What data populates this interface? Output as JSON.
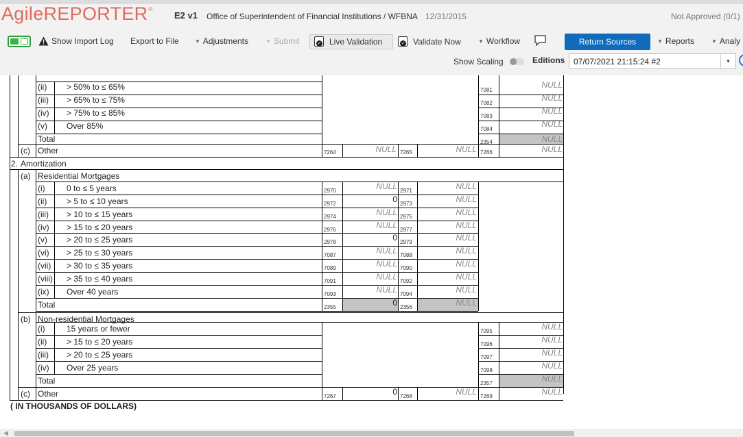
{
  "header": {
    "logo_text": "AgileREPORTER",
    "logo_mark": "®",
    "version": "E2 v1",
    "organization": "Office of Superintendent of Financial Institutions / WFBNA",
    "period_date": "12/31/2015",
    "approval_status": "Not Approved (0/1)"
  },
  "toolbar": {
    "show_import_log": "Show Import Log",
    "export_to_file": "Export to File",
    "adjustments": "Adjustments",
    "submit": "Submit",
    "live_validation": "Live Validation",
    "validate_now": "Validate Now",
    "workflow": "Workflow",
    "return_sources": "Return Sources",
    "reports": "Reports",
    "analysis": "Analy",
    "show_scaling": "Show Scaling",
    "editions_label": "Editions",
    "edition_value": "07/07/2021 21:15:24 #2"
  },
  "colors": {
    "brand": "#e36a5c",
    "primary_button": "#0f6cbd",
    "null_text": "#888888",
    "disabled_cell": "#c4c4c4"
  },
  "form": {
    "section1_rows": [
      {
        "num": "(ii)",
        "label": "> 50% to ≤ 65%",
        "code": "7081",
        "value": "NULL"
      },
      {
        "num": "(iii)",
        "label": "> 65% to ≤ 75%",
        "code": "7082",
        "value": "NULL"
      },
      {
        "num": "(iv)",
        "label": "> 75% to ≤ 85%",
        "code": "7083",
        "value": "NULL"
      },
      {
        "num": "(v)",
        "label": "Over 85%",
        "code": "7084",
        "value": "NULL"
      },
      {
        "num": "",
        "label": "Total",
        "code": "2354",
        "value": "NULL"
      }
    ],
    "other1": {
      "num": "(c)",
      "label": "Other",
      "code1": "7264",
      "val1": "NULL",
      "code2": "7265",
      "val2": "NULL",
      "code3": "7266",
      "val3": "NULL"
    },
    "section2": {
      "num": "2.",
      "label": "Amortization"
    },
    "res_mortgages": {
      "num": "(a)",
      "label": "Residential Mortgages"
    },
    "res_rows": [
      {
        "num": "(i)",
        "label": "0 to ≤ 5 years",
        "code1": "2970",
        "val1": "NULL",
        "code2": "2971",
        "val2": "NULL"
      },
      {
        "num": "(ii)",
        "label": "> 5 to ≤ 10 years",
        "code1": "2972",
        "val1": "0",
        "code2": "2973",
        "val2": "NULL"
      },
      {
        "num": "(iii)",
        "label": "> 10 to ≤ 15 years",
        "code1": "2974",
        "val1": "NULL",
        "code2": "2975",
        "val2": "NULL"
      },
      {
        "num": "(iv)",
        "label": "> 15 to ≤ 20 years",
        "code1": "2976",
        "val1": "NULL",
        "code2": "2977",
        "val2": "NULL"
      },
      {
        "num": "(v)",
        "label": "> 20 to ≤ 25 years",
        "code1": "2978",
        "val1": "0",
        "code2": "2979",
        "val2": "NULL"
      },
      {
        "num": "(vi)",
        "label": "> 25 to ≤ 30 years",
        "code1": "7087",
        "val1": "NULL",
        "code2": "7088",
        "val2": "NULL"
      },
      {
        "num": "(vii)",
        "label": "> 30 to ≤ 35 years",
        "code1": "7089",
        "val1": "NULL",
        "code2": "7090",
        "val2": "NULL"
      },
      {
        "num": "(viii)",
        "label": "> 35 to ≤ 40 years",
        "code1": "7091",
        "val1": "NULL",
        "code2": "7092",
        "val2": "NULL"
      },
      {
        "num": "(ix)",
        "label": "Over 40 years",
        "code1": "7093",
        "val1": "NULL",
        "code2": "7094",
        "val2": "NULL"
      },
      {
        "num": "",
        "label": "Total",
        "code1": "2355",
        "val1": "0",
        "code2": "2356",
        "val2": "NULL"
      }
    ],
    "nonres_mortgages": {
      "num": "(b)",
      "label": "Non-residential Mortgages"
    },
    "nonres_rows": [
      {
        "num": "(i)",
        "label": "15 years or fewer",
        "code": "7095",
        "value": "NULL"
      },
      {
        "num": "(ii)",
        "label": "> 15 to ≤ 20 years",
        "code": "7096",
        "value": "NULL"
      },
      {
        "num": "(iii)",
        "label": "> 20 to ≤ 25 years",
        "code": "7097",
        "value": "NULL"
      },
      {
        "num": "(iv)",
        "label": "Over 25 years",
        "code": "7098",
        "value": "NULL"
      },
      {
        "num": "",
        "label": "Total",
        "code": "2357",
        "value": "NULL"
      }
    ],
    "other2": {
      "num": "(c)",
      "label": "Other",
      "code1": "7267",
      "val1": "0",
      "code2": "7268",
      "val2": "NULL",
      "code3": "7269",
      "val3": "NULL"
    },
    "footer_note": "( IN THOUSANDS OF DOLLARS)"
  }
}
